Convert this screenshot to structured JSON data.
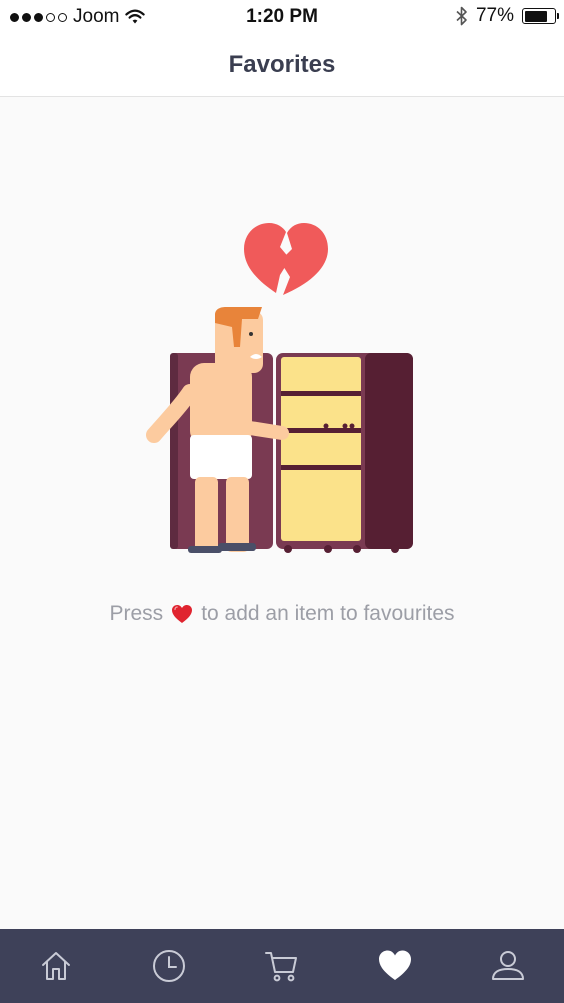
{
  "status_bar": {
    "carrier": "Joom",
    "time": "1:20 PM",
    "battery_percent": "77%",
    "battery_level": 0.77,
    "signal_bars_filled": 3,
    "signal_bars_total": 5
  },
  "header": {
    "title": "Favorites"
  },
  "empty_state": {
    "message_prefix": "Press",
    "message_suffix": "to add an item to favourites",
    "illustration_icon": "broken-heart-icon",
    "inline_icon": "heart-icon"
  },
  "tab_bar": {
    "active_tab": "favorites",
    "tabs": [
      {
        "id": "home",
        "icon": "home-icon"
      },
      {
        "id": "history",
        "icon": "clock-icon"
      },
      {
        "id": "cart",
        "icon": "cart-icon"
      },
      {
        "id": "favorites",
        "icon": "heart-icon"
      },
      {
        "id": "profile",
        "icon": "user-icon"
      }
    ]
  },
  "colors": {
    "tab_bar_bg": "#3e4159",
    "tab_icon": "#c9cbd6",
    "tab_icon_active": "#ffffff",
    "heart_red": "#f05a5a",
    "fridge_body": "#7a3a52",
    "fridge_shelf": "#fbe28a"
  }
}
